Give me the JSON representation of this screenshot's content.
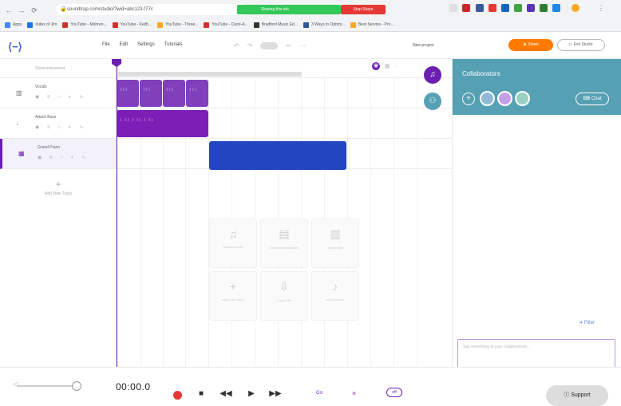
{
  "browser": {
    "url": "soundtrap.com/studio/?wid=abc123-f77c",
    "banner_text": "Sharing this tab",
    "stop_label": "Stop Share",
    "bookmarks": [
      {
        "label": "Apps",
        "color": "#4285f4"
      },
      {
        "label": "Index of Jim",
        "color": "#1a73e8"
      },
      {
        "label": "YouTube - Mohren...",
        "color": "#d32f2f"
      },
      {
        "label": "YouTube - Keith...",
        "color": "#d32f2f"
      },
      {
        "label": "YouTube - Three...",
        "color": "#f9a825"
      },
      {
        "label": "YouTube - Carol-A...",
        "color": "#d32f2f"
      },
      {
        "label": "Bradford Music Ed...",
        "color": "#333333"
      },
      {
        "label": "3 Ways to Optimi...",
        "color": "#2b5797"
      },
      {
        "label": "Best Service - Pro...",
        "color": "#f9a825"
      }
    ]
  },
  "app": {
    "menu": [
      "File",
      "Edit",
      "Settings",
      "Tutorials"
    ],
    "project_name": "New project",
    "share_label": "Share",
    "exit_label": "Exit Studio",
    "show_instrument": "Show instrument"
  },
  "tracks": [
    {
      "name": "Vocals",
      "icon": "mic-icon",
      "selected": false
    },
    {
      "name": "Attack Bass",
      "icon": "guitar-icon",
      "selected": false
    },
    {
      "name": "Grand Piano",
      "icon": "piano-icon",
      "selected": true
    }
  ],
  "add_track_label": "Add New Track",
  "presets": [
    {
      "icon": "♫",
      "label": "Browse loops"
    },
    {
      "icon": "▤",
      "label": "Drums & Beatmaker"
    },
    {
      "icon": "▥",
      "label": "Instrument"
    },
    {
      "icon": "+",
      "label": "Add voice track"
    },
    {
      "icon": "⇩",
      "label": "Import file"
    },
    {
      "icon": "♪",
      "label": "Invite friends"
    }
  ],
  "collab": {
    "title": "Collaborators",
    "chat_label": "Chat",
    "filter_label": "Filter",
    "message_placeholder": "Say something to your collaborators...",
    "avatars": [
      "#8fb9d9",
      "#c59ee8",
      "#9ad0c2"
    ]
  },
  "transport": {
    "time": "00:00.0",
    "metronome_label": "off",
    "support_label": "Support"
  },
  "colors": {
    "brand": "#6a1fb1",
    "drums_clip": "#6a1fb1",
    "bass_clip": "#7d1fb6",
    "piano_clip": "#2445c2",
    "collab_header": "#56a0b4",
    "share": "#ff7a00"
  }
}
